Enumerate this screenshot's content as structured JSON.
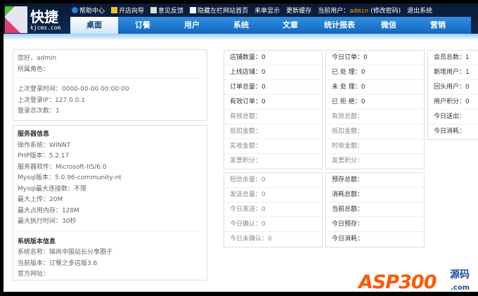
{
  "logo": {
    "name": "快捷",
    "domain": "kjcms.com"
  },
  "toplinks": [
    "帮助中心",
    "开店向导",
    "意见反馈",
    "隐藏左栏",
    "网站首页",
    "来单显示",
    "更新缓存"
  ],
  "current_user": {
    "label": "当前用户：",
    "name": "admin",
    "change_pwd": "(修改密码)",
    "logout": "退出系统"
  },
  "tabs": [
    "桌面",
    "订餐",
    "用户",
    "系统",
    "文章",
    "统计报表",
    "微信",
    "营销"
  ],
  "welcome": {
    "hello": "您好，admin",
    "role": "所属角色：",
    "last_time": "上次登录时间：0000-00-00 00:00:00",
    "last_ip": "上次登录IP：127.0.0.1",
    "count": "登录总次数：1"
  },
  "server": {
    "title": "服务器信息",
    "lines": [
      "操作系统：WINNT",
      "PHP版本：5.2.17",
      "服务器软件：Microsoft-IIS/6.0",
      "Mysql版本：5.0.96-community-nt",
      "Mysql最大连接数：不限",
      "最大上传：20M",
      "最大占用内存：128M",
      "最大执行时间：30秒"
    ]
  },
  "version": {
    "title": "系统版本信息",
    "lines": [
      "系统名称：锦尚中国站长分享圈子",
      "当前版本：订餐之多店版3.6",
      "官方网址："
    ]
  },
  "stats1": [
    "店铺数量：0",
    "上线店铺：0",
    "订单总量：0",
    "有效订单：0",
    "有效总额：",
    "抵扣金额：",
    "实收金额：",
    "发票积分："
  ],
  "stats2": [
    "今日订单：0",
    "已 处 理：0",
    "未 处 理：0",
    "已 拒 绝：0",
    "有效总额：",
    "抵扣金额：",
    "时收金额：",
    "发票积分："
  ],
  "stats3": [
    "会员总数：1",
    "新增用户：1",
    "回头用户：0",
    "用户积分：0",
    "今日送出：",
    "今日消耗："
  ],
  "sms": [
    "短信余量：0",
    "发送总量：0",
    "今日发送：0",
    "今日确认：0",
    "今日未确认：0"
  ],
  "money": [
    "预存总额：",
    "消耗总额：",
    "当前总额：",
    "今日预存：",
    "今日消耗："
  ],
  "watermark": {
    "text": "ASP300",
    "cn": "源码",
    "com": ".com"
  }
}
